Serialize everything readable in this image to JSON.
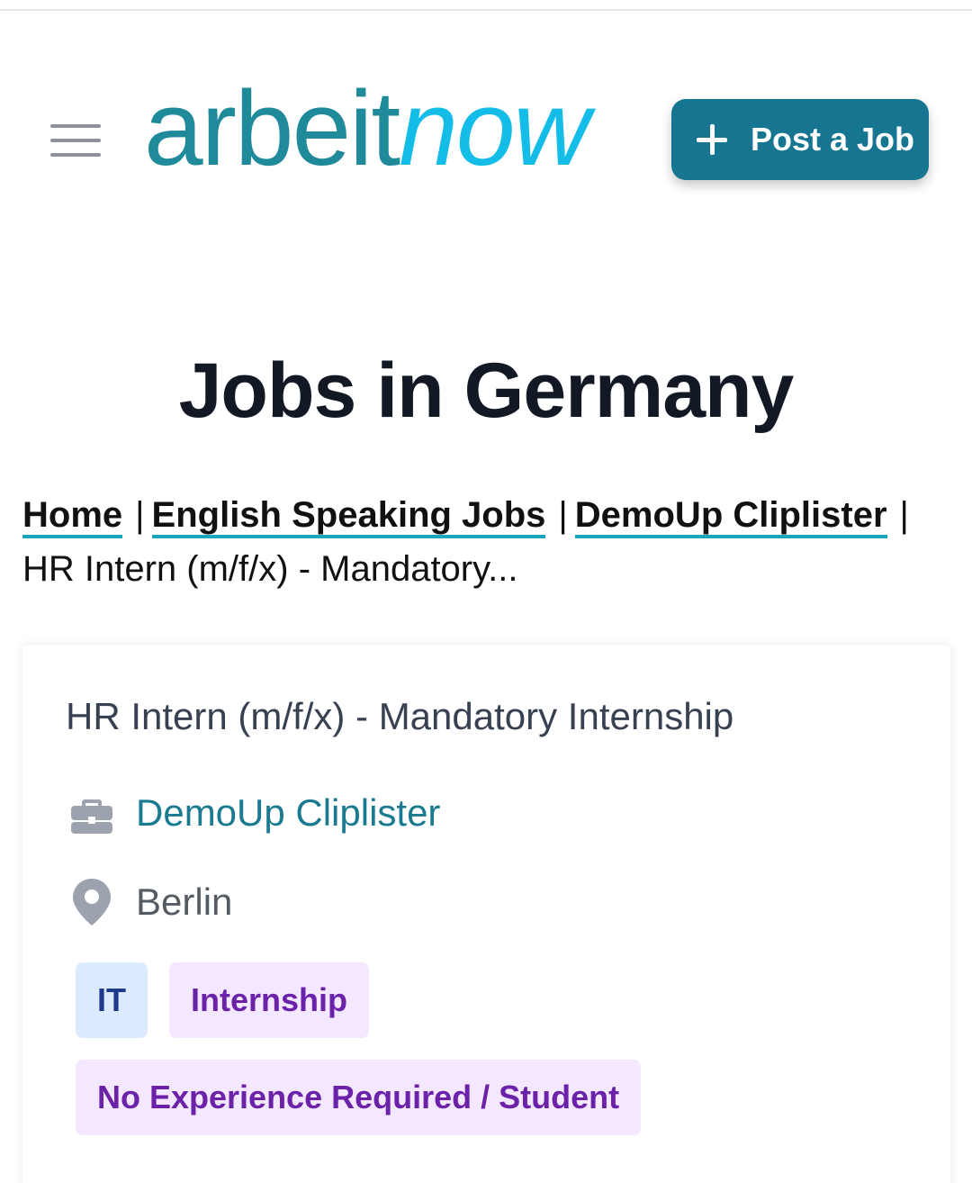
{
  "header": {
    "logo_part1": "arbeit",
    "logo_part2": "now",
    "post_job_label": "Post a Job",
    "menu_icon": "hamburger-menu-icon",
    "plus_icon": "plus-icon"
  },
  "page": {
    "title": "Jobs in Germany"
  },
  "breadcrumb": {
    "items": [
      "Home",
      "English Speaking Jobs",
      "DemoUp Cliplister"
    ],
    "separator": "|",
    "current": "HR Intern (m/f/x) - Mandatory..."
  },
  "job": {
    "title": "HR Intern (m/f/x) - Mandatory Internship",
    "company": "DemoUp Cliplister",
    "location": "Berlin",
    "company_icon": "briefcase-icon",
    "location_icon": "map-pin-icon",
    "tags": [
      "IT",
      "Internship",
      "No Experience Required / Student"
    ]
  },
  "colors": {
    "brand_teal": "#1f8a9a",
    "brand_cyan": "#14bde8",
    "button_bg": "#167590",
    "tag_blue_bg": "#dbeafe",
    "tag_purple_bg": "#f3e8ff",
    "tag_purple_text": "#6b21a8"
  }
}
